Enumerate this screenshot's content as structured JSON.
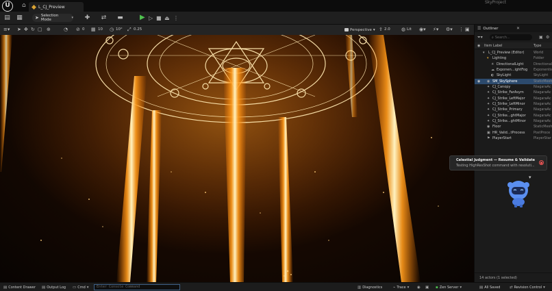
{
  "title_bar": {
    "logo": "unreal-logo",
    "tab_label": "L_CJ_Preview",
    "project_name": "SkyProject"
  },
  "toolbar": {
    "selection_mode_label": "Selection Mode"
  },
  "viewport_toolbar": {
    "translate_snap": "10",
    "rotate_snap": "10°",
    "scale_snap": "0.25",
    "perspective_label": "Perspective",
    "camera_speed": "2.0",
    "lit_label": "Lit",
    "level_value": "0"
  },
  "outliner": {
    "title": "Outliner",
    "search_placeholder": "Search...",
    "col_label": "Item Label",
    "col_type": "Type",
    "items": [
      {
        "indent": 1,
        "icon": "▾",
        "name": "L_CJ_Preview (Editor)",
        "type": "World",
        "selected": false
      },
      {
        "indent": 2,
        "icon": "▾",
        "name": "Lighting",
        "type": "Folder",
        "selected": false,
        "folder": true
      },
      {
        "indent": 3,
        "icon": "☀",
        "name": "DirectionalLight",
        "type": "Directional",
        "selected": false
      },
      {
        "indent": 3,
        "icon": "☁",
        "name": "Exponen...ightFog",
        "type": "Exponentia",
        "selected": false
      },
      {
        "indent": 3,
        "icon": "◐",
        "name": "SkyLight",
        "type": "SkyLight",
        "selected": false
      },
      {
        "indent": 2,
        "icon": "◉",
        "name": "SM_SkySphere",
        "type": "StaticMesh",
        "selected": true
      },
      {
        "indent": 2,
        "icon": "✦",
        "name": "CJ_Canopy",
        "type": "NiagaraAc",
        "selected": false
      },
      {
        "indent": 2,
        "icon": "✦",
        "name": "CJ_Strike_FarAsym",
        "type": "NiagaraAc",
        "selected": false
      },
      {
        "indent": 2,
        "icon": "✦",
        "name": "CJ_Strike_LeftMajor",
        "type": "NiagaraAc",
        "selected": false
      },
      {
        "indent": 2,
        "icon": "✦",
        "name": "CJ_Strike_LeftMinor",
        "type": "NiagaraAc",
        "selected": false
      },
      {
        "indent": 2,
        "icon": "✦",
        "name": "CJ_Strike_Primary",
        "type": "NiagaraAc",
        "selected": false
      },
      {
        "indent": 2,
        "icon": "✦",
        "name": "CJ_Strike...ghtMajor",
        "type": "NiagaraAc",
        "selected": false
      },
      {
        "indent": 2,
        "icon": "✦",
        "name": "CJ_Strike...ghtMinor",
        "type": "NiagaraAc",
        "selected": false
      },
      {
        "indent": 2,
        "icon": "◉",
        "name": "Floor",
        "type": "StaticMesh",
        "selected": false
      },
      {
        "indent": 2,
        "icon": "▣",
        "name": "HR_Valid...tProcess",
        "type": "PostProce",
        "selected": false
      },
      {
        "indent": 2,
        "icon": "⚑",
        "name": "PlayerStart",
        "type": "PlayerStar",
        "selected": false
      }
    ],
    "footer": "14 actors (1 selected)"
  },
  "toast": {
    "title": "Celestial Judgment — Resume & Validate",
    "message": "Testing HighResShot command with resoluti..."
  },
  "status_bar": {
    "content_drawer": "Content Drawer",
    "output_log": "Output Log",
    "cmd": "Cmd",
    "console_placeholder": "Enter Console Command",
    "diagnostics": "Diagnostics",
    "trace": "Trace",
    "zen_server": "Zen Server",
    "all_saved": "All Saved",
    "revision_control": "Revision Control"
  },
  "colors": {
    "accent_selection": "#2c4a6d",
    "play_green": "#4fc24f",
    "beam_gold": "#ffb84a"
  }
}
